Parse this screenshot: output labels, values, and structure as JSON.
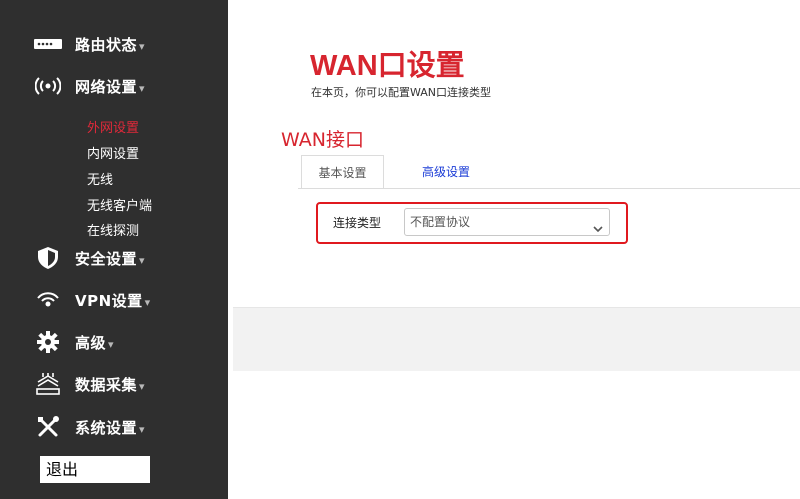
{
  "sidebar": {
    "items": [
      {
        "label": "路由状态",
        "icon": "router-status-icon"
      },
      {
        "label": "网络设置",
        "icon": "wireless-signal-icon"
      },
      {
        "label": "安全设置",
        "icon": "shield-icon"
      },
      {
        "label": "VPN设置",
        "icon": "vpn-signal-icon"
      },
      {
        "label": "高级",
        "icon": "gear-icon"
      },
      {
        "label": "数据采集",
        "icon": "data-collection-icon"
      },
      {
        "label": "系统设置",
        "icon": "tools-icon"
      }
    ],
    "caret": "▾",
    "submenu": [
      {
        "label": "外网设置",
        "active": true
      },
      {
        "label": "内网设置",
        "active": false
      },
      {
        "label": "无线",
        "active": false
      },
      {
        "label": "无线客户端",
        "active": false
      },
      {
        "label": "在线探测",
        "active": false
      }
    ],
    "logout_label": "退出"
  },
  "main": {
    "title": "WAN口设置",
    "subtitle": "在本页，你可以配置WAN口连接类型",
    "section_title": "WAN接口",
    "tabs": [
      {
        "label": "基本设置",
        "active": true
      },
      {
        "label": "高级设置",
        "active": false
      }
    ],
    "connection_type": {
      "label": "连接类型",
      "selected": "不配置协议"
    }
  },
  "colors": {
    "accent": "#d7252f",
    "sidebar_bg": "#2f2f2f",
    "link": "#1a3bd6",
    "highlight": "#e0191f"
  }
}
